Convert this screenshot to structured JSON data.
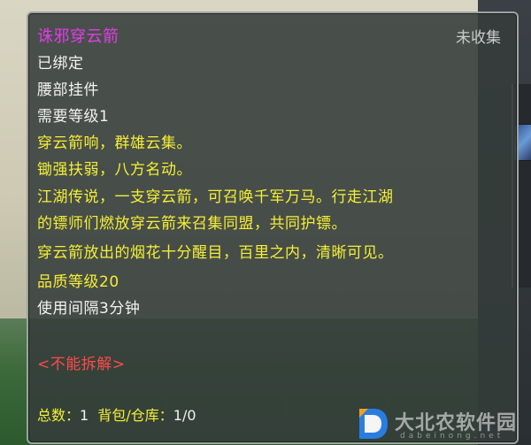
{
  "tooltip": {
    "item_name": "诛邪穿云箭",
    "collect_status": "未收集",
    "bound": "已绑定",
    "slot": "腰部挂件",
    "level_req": "需要等级1",
    "desc_lines": [
      "穿云箭响，群雄云集。",
      "锄强扶弱，八方名动。",
      "江湖传说，一支穿云箭，可召唤千军万马。行走江湖",
      "的镖师们燃放穿云箭来召集同盟，共同护镖。",
      "穿云箭放出的烟花十分醒目，百里之内，清晰可见。",
      "品质等级20"
    ],
    "cooldown": "使用间隔3分钟",
    "no_disassemble": "<不能拆解>",
    "footer": {
      "total_label": "总数：",
      "total_value": "1",
      "bag_label": "背包/仓库：",
      "bag_value": "1/0"
    }
  },
  "watermark": {
    "name": "大北农软件园",
    "sub": "dabeinong.net"
  },
  "colors": {
    "item_name": "#e23ce8",
    "description": "#f4ef36",
    "warning": "#ff4a4a",
    "normal": "#f2f2f2"
  }
}
